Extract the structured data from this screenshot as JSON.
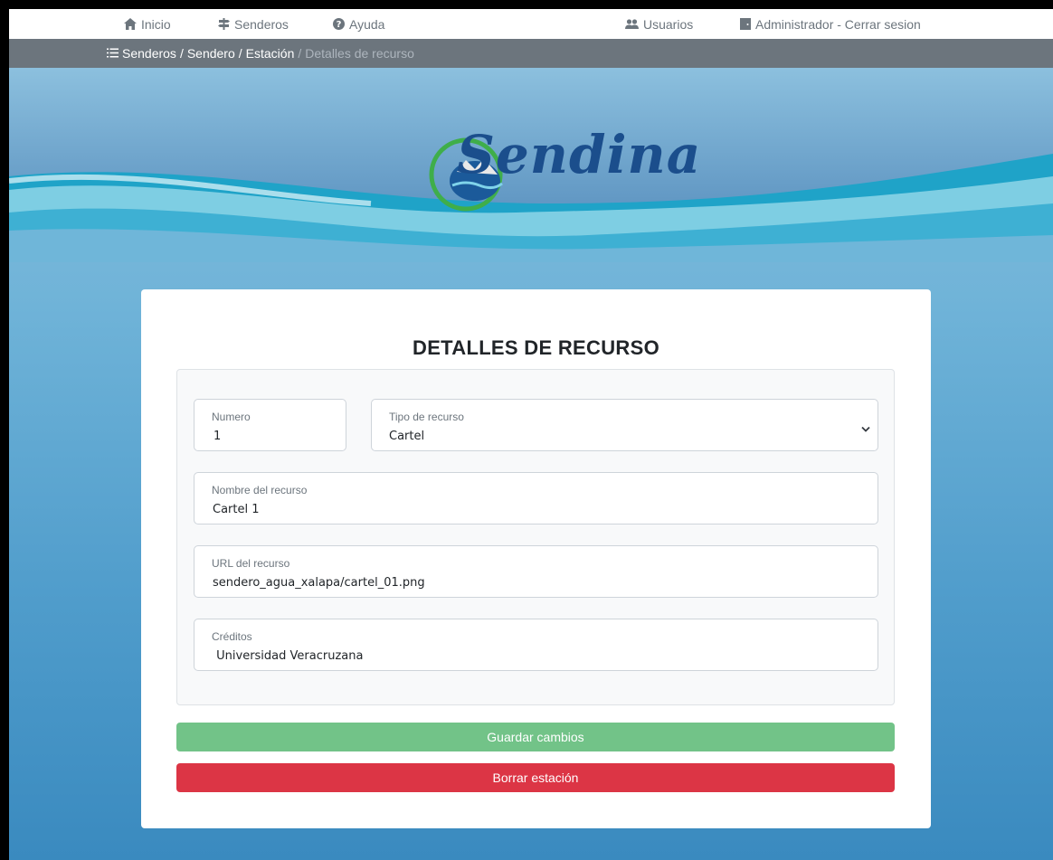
{
  "nav": {
    "inicio": "Inicio",
    "senderos": "Senderos",
    "ayuda": "Ayuda",
    "usuarios": "Usuarios",
    "admin": "Administrador - Cerrar sesion"
  },
  "breadcrumb": {
    "items": [
      "Senderos",
      "Sendero",
      "Estación"
    ],
    "active": "Detalles de recurso"
  },
  "hero": {
    "logo_text": "Sendina"
  },
  "form": {
    "title": "DETALLES DE RECURSO",
    "numero": {
      "label": "Numero",
      "value": "1"
    },
    "tipo": {
      "label": "Tipo de recurso",
      "value": "Cartel"
    },
    "nombre": {
      "label": "Nombre del recurso",
      "value": "Cartel 1"
    },
    "url": {
      "label": "URL del recurso",
      "value": "sendero_agua_xalapa/cartel_01.png"
    },
    "creditos": {
      "label": "Créditos",
      "value": " Universidad Veracruzana"
    }
  },
  "buttons": {
    "save": "Guardar cambios",
    "delete": "Borrar estación"
  },
  "colors": {
    "save": "#72c388",
    "delete": "#dc3545",
    "breadcrumb_bg": "#6c757d"
  }
}
